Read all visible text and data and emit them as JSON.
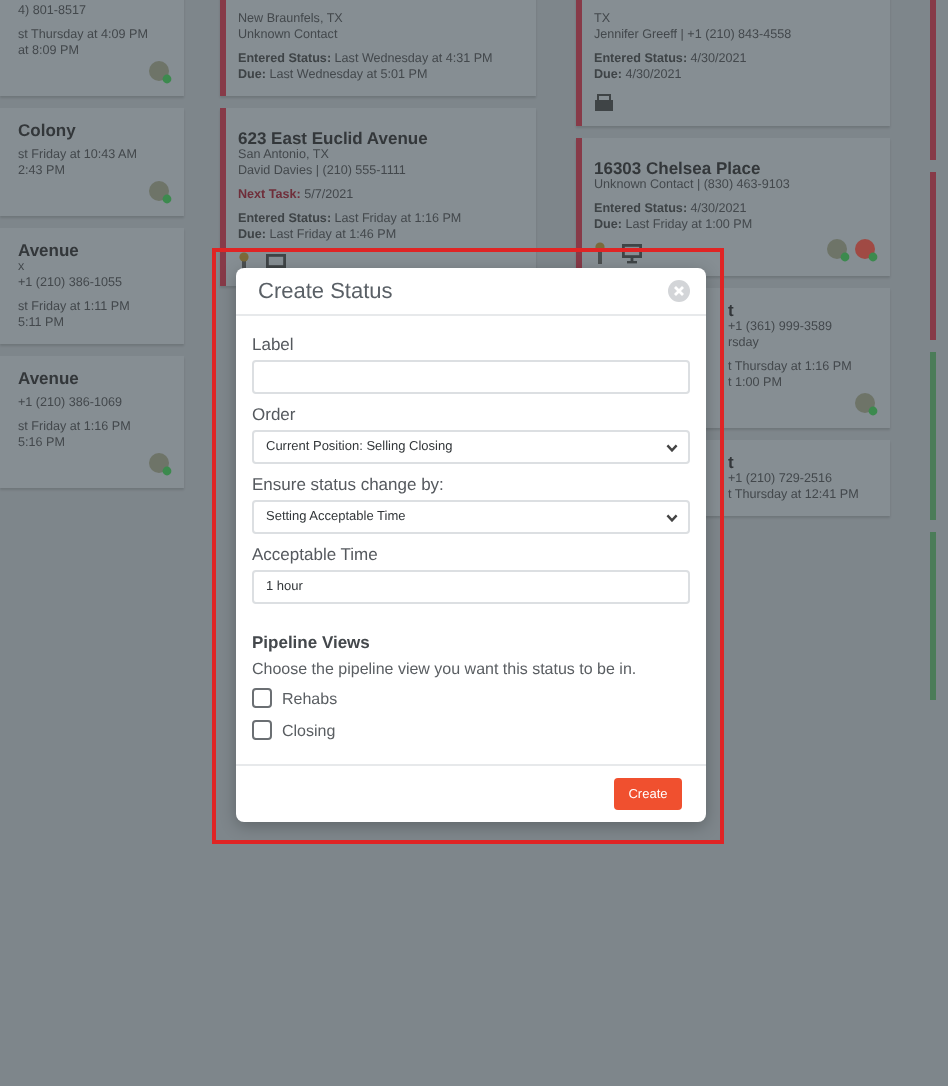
{
  "board": {
    "columns": [
      {
        "cards": [
          {
            "groups": [
              [
                {
                  "kind": "text",
                  "text": "4) 801-8517"
                }
              ],
              [
                {
                  "kind": "text",
                  "text": "st Thursday at 4:09 PM"
                },
                {
                  "kind": "text",
                  "text": "at 8:09 PM"
                }
              ],
              [
                {
                  "kind": "avatars",
                  "avatars": [
                    {
                      "color": "#6e7468"
                    }
                  ]
                }
              ]
            ]
          },
          {
            "groups": [
              [
                {
                  "kind": "title",
                  "text": "Colony"
                }
              ],
              [
                {
                  "kind": "text",
                  "text": "st Friday at 10:43 AM"
                },
                {
                  "kind": "text",
                  "text": "2:43 PM"
                }
              ],
              [
                {
                  "kind": "avatars",
                  "avatars": [
                    {
                      "color": "#6e7468"
                    }
                  ]
                }
              ]
            ]
          },
          {
            "groups": [
              [
                {
                  "kind": "title",
                  "text": "Avenue"
                },
                {
                  "kind": "text",
                  "text": "x"
                },
                {
                  "kind": "text",
                  "text": "+1 (210) 386-1055"
                }
              ],
              [
                {
                  "kind": "text",
                  "text": "st Friday at 1:11 PM"
                },
                {
                  "kind": "text",
                  "text": "5:11 PM"
                }
              ]
            ]
          },
          {
            "groups": [
              [
                {
                  "kind": "title",
                  "text": "Avenue"
                }
              ],
              [
                {
                  "kind": "text",
                  "text": "+1 (210) 386-1069"
                }
              ],
              [
                {
                  "kind": "text",
                  "text": "st Friday at 1:16 PM"
                },
                {
                  "kind": "text",
                  "text": "5:16 PM"
                }
              ],
              [
                {
                  "kind": "avatars",
                  "avatars": [
                    {
                      "color": "#6e7468"
                    }
                  ]
                }
              ]
            ]
          }
        ]
      },
      {
        "cards": [
          {
            "color": "#873a48",
            "groups": [
              [
                {
                  "kind": "text",
                  "text": "New Braunfels, TX"
                },
                {
                  "kind": "text",
                  "text": "Unknown Contact"
                }
              ],
              [
                {
                  "kind": "field",
                  "label": "Entered Status:",
                  "value": "Last Wednesday at 4:31 PM"
                },
                {
                  "kind": "field",
                  "label": "Due:",
                  "value": "Last Wednesday at 5:01 PM"
                }
              ]
            ]
          },
          {
            "color": "#873a48",
            "groups": [
              [
                {
                  "kind": "title",
                  "text": "623 East Euclid Avenue"
                },
                {
                  "kind": "text",
                  "text": "San Antonio, TX"
                },
                {
                  "kind": "text",
                  "text": "David Davies | (210) 555-1111"
                }
              ],
              [
                {
                  "kind": "task",
                  "label": "Next Task:",
                  "value": "5/7/2021"
                }
              ],
              [
                {
                  "kind": "field",
                  "label": "Entered Status:",
                  "value": "Last Friday at 1:16 PM"
                },
                {
                  "kind": "field",
                  "label": "Due:",
                  "value": "Last Friday at 1:46 PM"
                }
              ],
              [
                {
                  "kind": "icons",
                  "icons": [
                    {
                      "kind": "pin"
                    },
                    {
                      "kind": "screen"
                    }
                  ]
                }
              ]
            ]
          }
        ]
      },
      {
        "cards": [
          {
            "color": "#873a48",
            "groups": [
              [
                {
                  "kind": "text",
                  "text": "TX"
                },
                {
                  "kind": "text",
                  "text": "Jennifer Greeff | +1 (210) 843-4558"
                }
              ],
              [
                {
                  "kind": "field",
                  "label": "Entered Status:",
                  "value": "4/30/2021"
                },
                {
                  "kind": "field",
                  "label": "Due:",
                  "value": "4/30/2021"
                }
              ],
              [
                {
                  "kind": "icons",
                  "icons": [
                    {
                      "kind": "tray"
                    }
                  ]
                }
              ]
            ]
          },
          {
            "color": "#873a48",
            "groups": [
              [
                {
                  "kind": "title",
                  "text": "16303 Chelsea Place"
                },
                {
                  "kind": "text",
                  "text": "Unknown Contact | (830) 463-9103"
                }
              ],
              [
                {
                  "kind": "field",
                  "label": "Entered Status:",
                  "value": "4/30/2021"
                },
                {
                  "kind": "field",
                  "label": "Due:",
                  "value": "Last Friday at 1:00 PM"
                }
              ],
              [
                {
                  "kind": "icons",
                  "icons": [
                    {
                      "kind": "pin"
                    },
                    {
                      "kind": "screen"
                    }
                  ]
                },
                {
                  "kind": "avatars",
                  "avatars": [
                    {
                      "color": "#6e7468"
                    },
                    {
                      "color": "#a04a44"
                    }
                  ]
                }
              ]
            ]
          },
          {
            "groups": [
              [
                {
                  "kind": "title",
                  "text": "t"
                },
                {
                  "kind": "text",
                  "text": "+1 (361) 999-3589"
                },
                {
                  "kind": "text",
                  "text": "rsday"
                }
              ],
              [
                {
                  "kind": "text",
                  "text": "t Thursday at 1:16 PM"
                },
                {
                  "kind": "text",
                  "text": "t 1:00 PM"
                }
              ],
              [
                {
                  "kind": "avatars",
                  "avatars": [
                    {
                      "color": "#6e7468"
                    }
                  ]
                }
              ]
            ]
          },
          {
            "groups": [
              [
                {
                  "kind": "title",
                  "text": "t"
                },
                {
                  "kind": "text",
                  "text": "+1 (210) 729-2516"
                },
                {
                  "kind": "text",
                  "text": "t Thursday at 12:41 PM"
                }
              ]
            ]
          }
        ]
      },
      {
        "cards": [
          {
            "color": "#873a48"
          },
          {
            "color": "#873a48"
          },
          {
            "color": "#4b7c58"
          },
          {
            "color": "#4b7c58"
          }
        ]
      }
    ]
  },
  "dialog": {
    "title": "Create Status",
    "fields": [
      {
        "kind": "input",
        "label": "Label"
      },
      {
        "kind": "select",
        "label": "Order",
        "value": "Current Position: Selling Closing"
      },
      {
        "kind": "select",
        "label": "Ensure status change by:",
        "value": "Setting Acceptable Time"
      },
      {
        "kind": "input",
        "label": "Acceptable Time",
        "value": "1 hour"
      }
    ],
    "section": {
      "title": "Pipeline Views",
      "description": "Choose the pipeline view you want this status to be in.",
      "options": [
        {
          "label": "Rehabs",
          "checked": false
        },
        {
          "label": "Closing",
          "checked": false
        }
      ]
    },
    "primary_button": "Create"
  },
  "highlight": {
    "color": "#e02424"
  }
}
